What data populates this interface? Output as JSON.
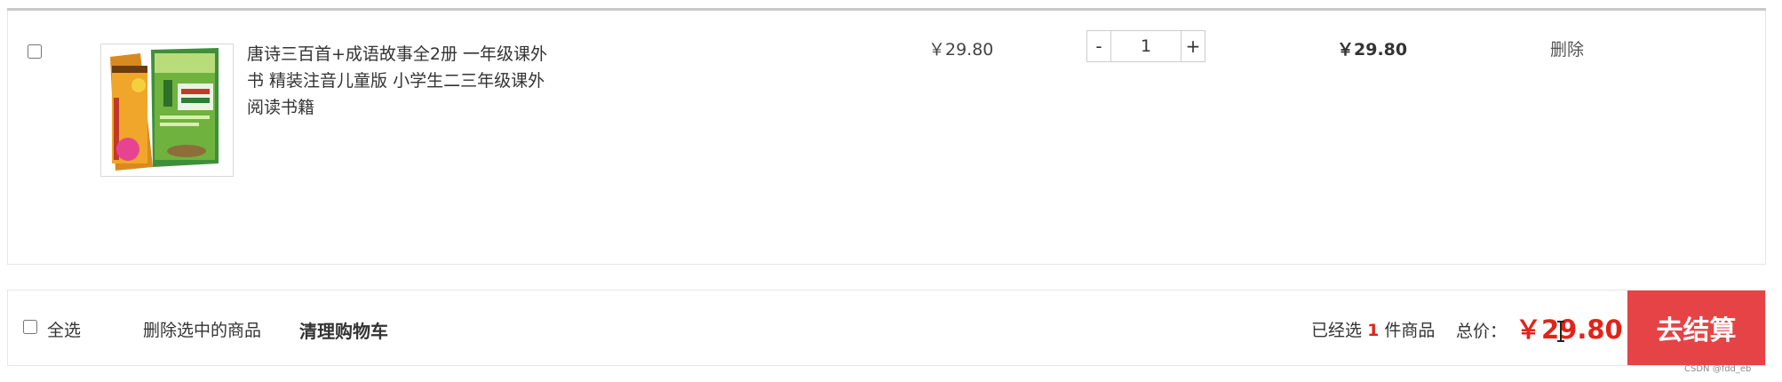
{
  "item": {
    "title": "唐诗三百首+成语故事全2册 一年级课外书 精装注音儿童版 小学生二三年级课外阅读书籍",
    "thumbnail_icon": "book-cover-image",
    "unit_price": "￥29.80",
    "quantity": "1",
    "decrement_label": "-",
    "increment_label": "+",
    "subtotal": "￥29.80",
    "delete_label": "删除"
  },
  "footer": {
    "select_all_label": "全选",
    "delete_selected_label": "删除选中的商品",
    "clear_cart_label": "清理购物车",
    "selected_prefix": "已经选",
    "selected_count": "1",
    "selected_suffix": "件商品",
    "total_label": "总价：",
    "total_value": "￥29.80",
    "checkout_label": "去结算"
  },
  "colors": {
    "accent": "#e54346",
    "price_red": "#e2231a"
  },
  "watermark": "CSDN @fdd_eb"
}
